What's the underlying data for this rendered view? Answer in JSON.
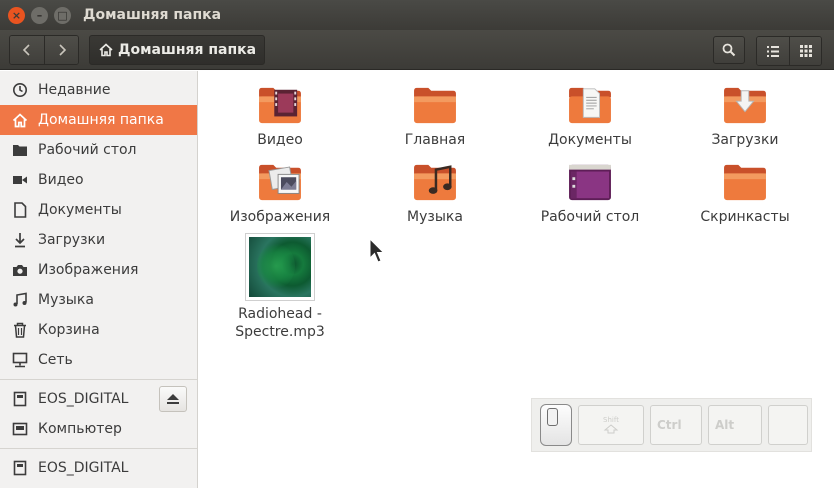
{
  "window": {
    "title": "Домашняя папка",
    "buttons": {
      "close": "×",
      "minimize": "–",
      "maximize": "□"
    }
  },
  "toolbar": {
    "back_icon": "chevron-left-icon",
    "forward_icon": "chevron-right-icon",
    "path_label": "Домашняя папка",
    "search_icon": "search-icon",
    "list_view_icon": "list-view-icon",
    "grid_view_icon": "grid-view-icon"
  },
  "sidebar": {
    "places": [
      {
        "label": "Недавние",
        "icon": "clock-icon",
        "active": false
      },
      {
        "label": "Домашняя папка",
        "icon": "home-icon",
        "active": true
      },
      {
        "label": "Рабочий стол",
        "icon": "folder-icon",
        "active": false
      },
      {
        "label": "Видео",
        "icon": "video-icon",
        "active": false
      },
      {
        "label": "Документы",
        "icon": "document-icon",
        "active": false
      },
      {
        "label": "Загрузки",
        "icon": "download-icon",
        "active": false
      },
      {
        "label": "Изображения",
        "icon": "camera-icon",
        "active": false
      },
      {
        "label": "Музыка",
        "icon": "music-icon",
        "active": false
      },
      {
        "label": "Корзина",
        "icon": "trash-icon",
        "active": false
      },
      {
        "label": "Сеть",
        "icon": "network-icon",
        "active": false
      }
    ],
    "devices": [
      {
        "label": "EOS_DIGITAL",
        "icon": "drive-icon",
        "eject": true
      },
      {
        "label": "Компьютер",
        "icon": "computer-icon",
        "eject": false
      }
    ],
    "network": [
      {
        "label": "EOS_DIGITAL",
        "icon": "drive-icon"
      }
    ]
  },
  "files": [
    {
      "label": "Видео",
      "icon": "video-folder-icon"
    },
    {
      "label": "Главная",
      "icon": "folder-icon"
    },
    {
      "label": "Документы",
      "icon": "documents-folder-icon"
    },
    {
      "label": "Загрузки",
      "icon": "downloads-folder-icon"
    },
    {
      "label": "Изображения",
      "icon": "pictures-folder-icon"
    },
    {
      "label": "Музыка",
      "icon": "music-folder-icon"
    },
    {
      "label": "Рабочий стол",
      "icon": "desktop-folder-icon"
    },
    {
      "label": "Скринкасты",
      "icon": "folder-icon"
    },
    {
      "label_line1": "Radiohead -",
      "label_line2": "Spectre.mp3",
      "icon": "album-art-thumbnail"
    }
  ],
  "key_overlay": {
    "shift": "Shift",
    "ctrl": "Ctrl",
    "alt": "Alt"
  },
  "colors": {
    "accent": "#F07746",
    "titlebar": "#3C3B37",
    "folder_orange": "#E8662D"
  }
}
